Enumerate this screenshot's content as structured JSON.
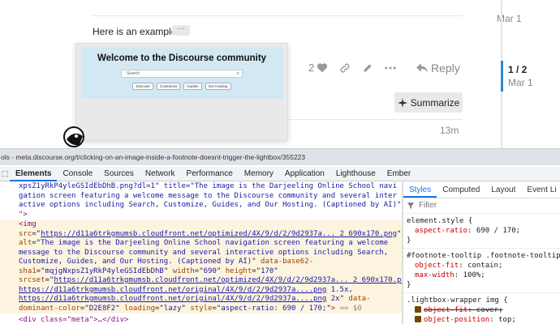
{
  "page": {
    "top_date": "Mar 1",
    "post_text": "Here is an example",
    "footnote_button": "···",
    "tooltip_image": {
      "title": "Welcome to the Discourse community",
      "search_placeholder": "Search",
      "buttons": [
        "Discover",
        "Customize",
        "Guides",
        "Our Hosting"
      ]
    },
    "like_count": "2",
    "reply_label": "Reply",
    "timeline_position": "1 / 2",
    "timeline_date": "Mar 1",
    "summarize_label": "Summarize",
    "next_post_time": "13m"
  },
  "devtools": {
    "title_bar": "ols - meta.discourse.org/t/clicking-on-an-image-inside-a-footnote-doesnt-trigger-the-lightbox/355223",
    "tabs": [
      "Elements",
      "Console",
      "Sources",
      "Network",
      "Performance",
      "Memory",
      "Application",
      "Lighthouse",
      "Ember"
    ],
    "active_tab": "Elements",
    "elements_top_lines": [
      "xpsZ1yRkP4yleGSIdEbDhB.png?dl=1\" title=\"The image is the Darjeeling Online School navi",
      "gation screen featuring a welcome message to the Discourse community and several inter",
      "active options including Search, Customize, Guides, and Our Hosting. (Captioned by AI)\"",
      "\">"
    ],
    "img_element": {
      "open": "<img",
      "src_attr": "src",
      "src_value": "https://d11a6trkgmumsb.cloudfront.net/optimized/4X/9/d/2/9d2937a..._2_690x170.png",
      "alt_attr": "alt",
      "alt_value": "The image is the Darjeeling Online School navigation screen featuring a welcome message to the Discourse community and several interactive options including Search, Customize, Guides, and Our Hosting. (Captioned by AI)",
      "b64_attr": "data-base62-sha1",
      "b64_value": "mqjgNxpsZ1yRkP4yleGSIdEbDhB",
      "width_attr": "width",
      "width_value": "690",
      "height_attr": "height",
      "height_value": "170",
      "srcset_attr": "srcset",
      "srcset_1": "https://d11a6trkgmumsb.cloudfront.net/optimized/4X/9/d/2/9d2937a..._2_690x170.png",
      "srcset_1_suffix": ", ",
      "srcset_2": "https://d11a6trkgmumsb.cloudfront.net/original/4X/9/d/2/9d2937a....png",
      "srcset_2_suffix": " 1.5x, ",
      "srcset_3": "https://d11a6trkgmumsb.cloudfront.net/original/4X/9/d/2/9d2937a....png",
      "srcset_3_suffix": " 2x",
      "color_attr": "data-dominant-color",
      "color_value": "D2E8F2",
      "loading_attr": "loading",
      "loading_value": "lazy",
      "style_attr": "style",
      "style_value": "aspect-ratio: 690 / 170;",
      "close": ">",
      "eq": "== $0"
    },
    "elements_bottom": "<div class=\"meta\">…</div>",
    "styles": {
      "tabs": [
        "Styles",
        "Computed",
        "Layout",
        "Event Li"
      ],
      "active_tab": "Styles",
      "filter_placeholder": "Filter",
      "rules": [
        {
          "selector": "element.style {",
          "props": [
            {
              "name": "aspect-ratio",
              "value": "690 / 170;",
              "struck": false
            }
          ]
        },
        {
          "selector": "#footnote-tooltip .footnote-tooltip-",
          "props": [
            {
              "name": "object-fit",
              "value": "contain;",
              "struck": false
            },
            {
              "name": "max-width",
              "value": "100%;",
              "struck": false
            }
          ]
        },
        {
          "selector": ".lightbox-wrapper img {",
          "props": [
            {
              "name": "object-fit",
              "value": "cover;",
              "struck": true
            },
            {
              "name": "object-position",
              "value": "top;",
              "struck": false
            }
          ]
        }
      ]
    }
  },
  "colors": {
    "accent": "#1a73e8",
    "timeline_handle": "#2a87d0",
    "selected_element_bg": "#fdf4e0",
    "tooltip_image_bg": "#d2e8f2"
  }
}
